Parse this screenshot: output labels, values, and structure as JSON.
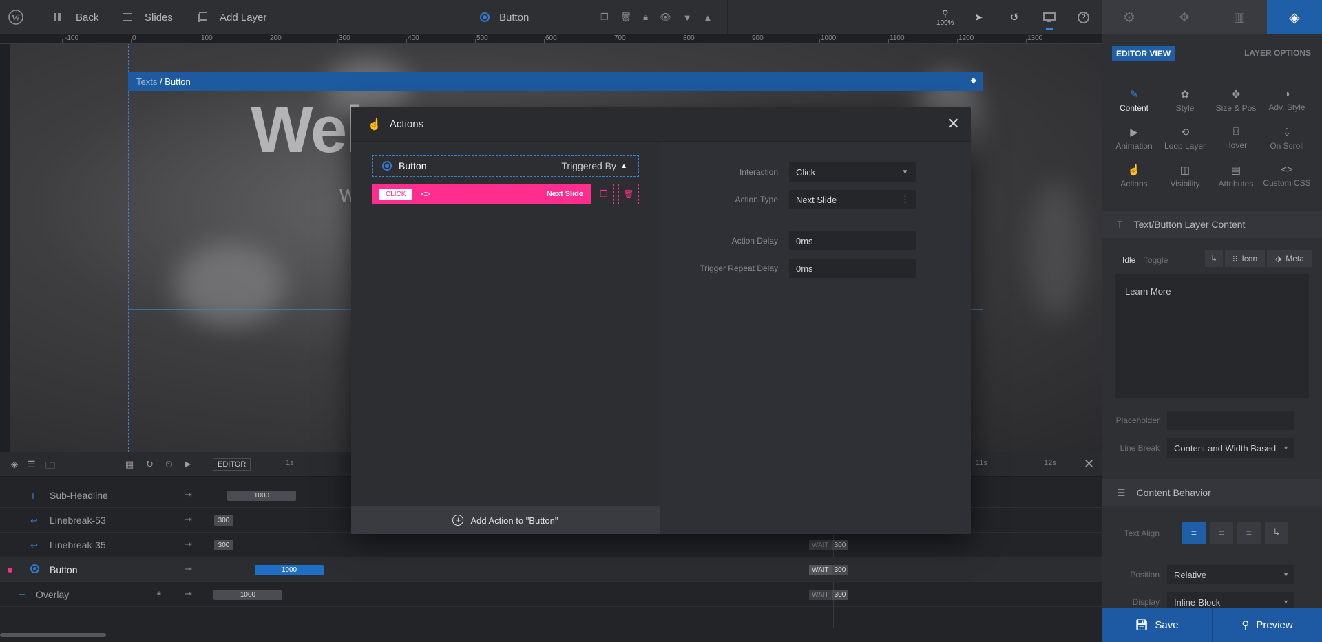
{
  "topbar": {
    "back": "Back",
    "slides": "Slides",
    "add_layer": "Add Layer",
    "current_layer": "Button",
    "zoom": "100%"
  },
  "ruler": {
    "ticks": [
      "-100",
      "0",
      "100",
      "200",
      "300",
      "400",
      "500",
      "600",
      "700",
      "800",
      "900",
      "1000",
      "1100",
      "1200",
      "1300"
    ]
  },
  "stage": {
    "breadcrumb_parent": "Texts",
    "breadcrumb_sep": " / ",
    "breadcrumb_current": "Button",
    "headline_partial": "Wel",
    "sub_partial": "W"
  },
  "timeline": {
    "editor_label": "EDITOR",
    "time_1s": "1s",
    "time_11s": "11s",
    "time_12s": "12s",
    "rows": [
      {
        "name": "Sub-Headline",
        "bar": "1000"
      },
      {
        "name": "Linebreak-53",
        "bar": "300"
      },
      {
        "name": "Linebreak-35",
        "bar": "300",
        "wait": "WAIT",
        "wait_val": "300"
      },
      {
        "name": "Button",
        "bar": "1000",
        "wait": "WAIT",
        "wait_val": "300"
      },
      {
        "name": "Overlay",
        "bar": "1000",
        "wait": "WAIT",
        "wait_val": "300"
      }
    ]
  },
  "modal": {
    "title": "Actions",
    "trigger_source": "Button",
    "triggered_by": "Triggered By",
    "action_badge": "CLICK",
    "action_name": "Next Slide",
    "add_action": "Add Action to \"Button\"",
    "fields": {
      "interaction_label": "Interaction",
      "interaction_value": "Click",
      "action_type_label": "Action Type",
      "action_type_value": "Next Slide",
      "action_delay_label": "Action Delay",
      "action_delay_value": "0ms",
      "trigger_repeat_label": "Trigger Repeat Delay",
      "trigger_repeat_value": "0ms"
    }
  },
  "rpanel": {
    "editor_view": "EDITOR VIEW",
    "layer_options": "LAYER OPTIONS",
    "options": [
      "Content",
      "Style",
      "Size & Pos",
      "Adv. Style",
      "Animation",
      "Loop Layer",
      "Hover",
      "On Scroll",
      "Actions",
      "Visibility",
      "Attributes",
      "Custom CSS"
    ],
    "content_section": "Text/Button Layer Content",
    "tab_idle": "Idle",
    "tab_toggle": "Toggle",
    "icon_label": "Icon",
    "meta_label": "Meta",
    "content_text": "Learn More",
    "placeholder_label": "Placeholder",
    "linebreak_label": "Line Break",
    "linebreak_value": "Content and Width Based",
    "behavior_section": "Content Behavior",
    "text_align_label": "Text Align",
    "position_label": "Position",
    "position_value": "Relative",
    "display_label": "Display",
    "display_value": "Inline-Block"
  },
  "footer": {
    "save": "Save",
    "preview": "Preview"
  },
  "colors": {
    "accent": "#1f5fa8",
    "action_pink": "#ff2d8e",
    "bg": "#2b2c30"
  }
}
